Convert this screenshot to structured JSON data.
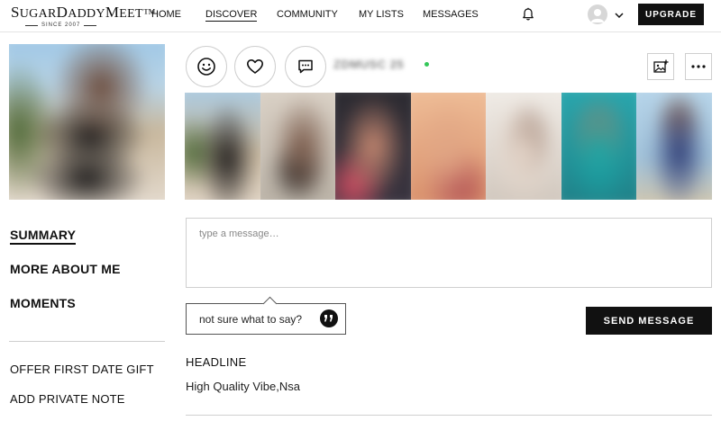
{
  "brand": {
    "name_part1_cap": "S",
    "name_part1": "UGAR",
    "name_part2_cap": "D",
    "name_part2": "ADDY",
    "name_part3_cap": "M",
    "name_part3": "EET",
    "trademark": "™",
    "since": "SINCE 2007"
  },
  "nav": {
    "items": [
      {
        "label": "HOME"
      },
      {
        "label": "DISCOVER"
      },
      {
        "label": "COMMUNITY"
      },
      {
        "label": "MY LISTS"
      },
      {
        "label": "MESSAGES"
      }
    ],
    "active": "DISCOVER",
    "upgrade_label": "UPGRADE"
  },
  "profile": {
    "username": "ZDMUSC 25",
    "online": true
  },
  "sidebar": {
    "sections": [
      {
        "label": "SUMMARY"
      },
      {
        "label": "MORE ABOUT ME"
      },
      {
        "label": "MOMENTS"
      }
    ],
    "actions": [
      {
        "label": "OFFER FIRST DATE GIFT"
      },
      {
        "label": "ADD PRIVATE NOTE"
      }
    ]
  },
  "message": {
    "placeholder": "type a message…",
    "suggestion": "not sure what to say?",
    "send_label": "SEND MESSAGE"
  },
  "headline": {
    "title": "HEADLINE",
    "text": "High Quality Vibe,Nsa"
  },
  "icons": {
    "wink": "smile-face-icon",
    "favorite": "heart-icon",
    "chat": "chat-bubble-icon",
    "photo_request": "photo-add-icon",
    "more": "ellipsis-icon",
    "notifications": "bell-icon",
    "account_menu": "chevron-down-icon",
    "suggestion": "quote-icon"
  },
  "colors": {
    "primary": "#111111",
    "online": "#34c759",
    "border": "#cfcfcf"
  }
}
